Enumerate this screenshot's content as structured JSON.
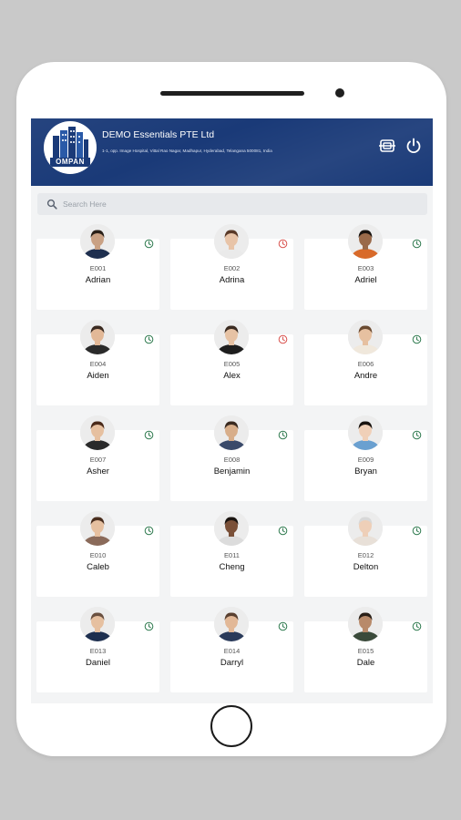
{
  "header": {
    "company_name": "DEMO Essentials  PTE Ltd",
    "company_address": "1-1, opp. Image Hospital, Vittal Rao Nagar, Madhapur, Hyderabad, Telangana 500081, India",
    "logo_text": "OMPAN",
    "brand_color": "#1a3a78"
  },
  "search": {
    "placeholder": "Search Here"
  },
  "status_colors": {
    "in": "#2f7a4f",
    "out": "#d9534f"
  },
  "employees": [
    {
      "code": "E001",
      "name": "Adrian",
      "status": "in",
      "skin": "#c9a184",
      "hair": "#2a2018",
      "shirt": "#1e2f4f"
    },
    {
      "code": "E002",
      "name": "Adrina",
      "status": "out",
      "skin": "#e8c4a8",
      "hair": "#5a3a28",
      "shirt": "#eaeaea"
    },
    {
      "code": "E003",
      "name": "Adriel",
      "status": "in",
      "skin": "#9a6a4a",
      "hair": "#1a1410",
      "shirt": "#d86a2a"
    },
    {
      "code": "E004",
      "name": "Aiden",
      "status": "in",
      "skin": "#e2b897",
      "hair": "#3a2a20",
      "shirt": "#2a2a2a"
    },
    {
      "code": "E005",
      "name": "Alex",
      "status": "out",
      "skin": "#e6c2a4",
      "hair": "#3a2a20",
      "shirt": "#1e1e1e"
    },
    {
      "code": "E006",
      "name": "Andre",
      "status": "in",
      "skin": "#e6c0a0",
      "hair": "#6a4a30",
      "shirt": "#f0e8dc"
    },
    {
      "code": "E007",
      "name": "Asher",
      "status": "in",
      "skin": "#e6c0a0",
      "hair": "#4a2a1a",
      "shirt": "#2a2a2a"
    },
    {
      "code": "E008",
      "name": "Benjamin",
      "status": "in",
      "skin": "#d8ae8a",
      "hair": "#3a2a20",
      "shirt": "#3a4a6a"
    },
    {
      "code": "E009",
      "name": "Bryan",
      "status": "in",
      "skin": "#f0d0b8",
      "hair": "#1a1410",
      "shirt": "#6aa0d0"
    },
    {
      "code": "E010",
      "name": "Caleb",
      "status": "in",
      "skin": "#e6c0a0",
      "hair": "#4a2e1e",
      "shirt": "#8a6a5a"
    },
    {
      "code": "E011",
      "name": "Cheng",
      "status": "in",
      "skin": "#7a5038",
      "hair": "#1a1410",
      "shirt": "#dcdcdc"
    },
    {
      "code": "E012",
      "name": "Delton",
      "status": "in",
      "skin": "#eecfb8",
      "hair": "#d8d8d8",
      "shirt": "#e8e0d8"
    },
    {
      "code": "E013",
      "name": "Daniel",
      "status": "in",
      "skin": "#e6c0a0",
      "hair": "#6a5040",
      "shirt": "#1e2f4f"
    },
    {
      "code": "E014",
      "name": "Darryl",
      "status": "in",
      "skin": "#e2b897",
      "hair": "#5a4030",
      "shirt": "#2a3a5a"
    },
    {
      "code": "E015",
      "name": "Dale",
      "status": "in",
      "skin": "#b88a6a",
      "hair": "#2a2018",
      "shirt": "#3a4a3a"
    }
  ]
}
